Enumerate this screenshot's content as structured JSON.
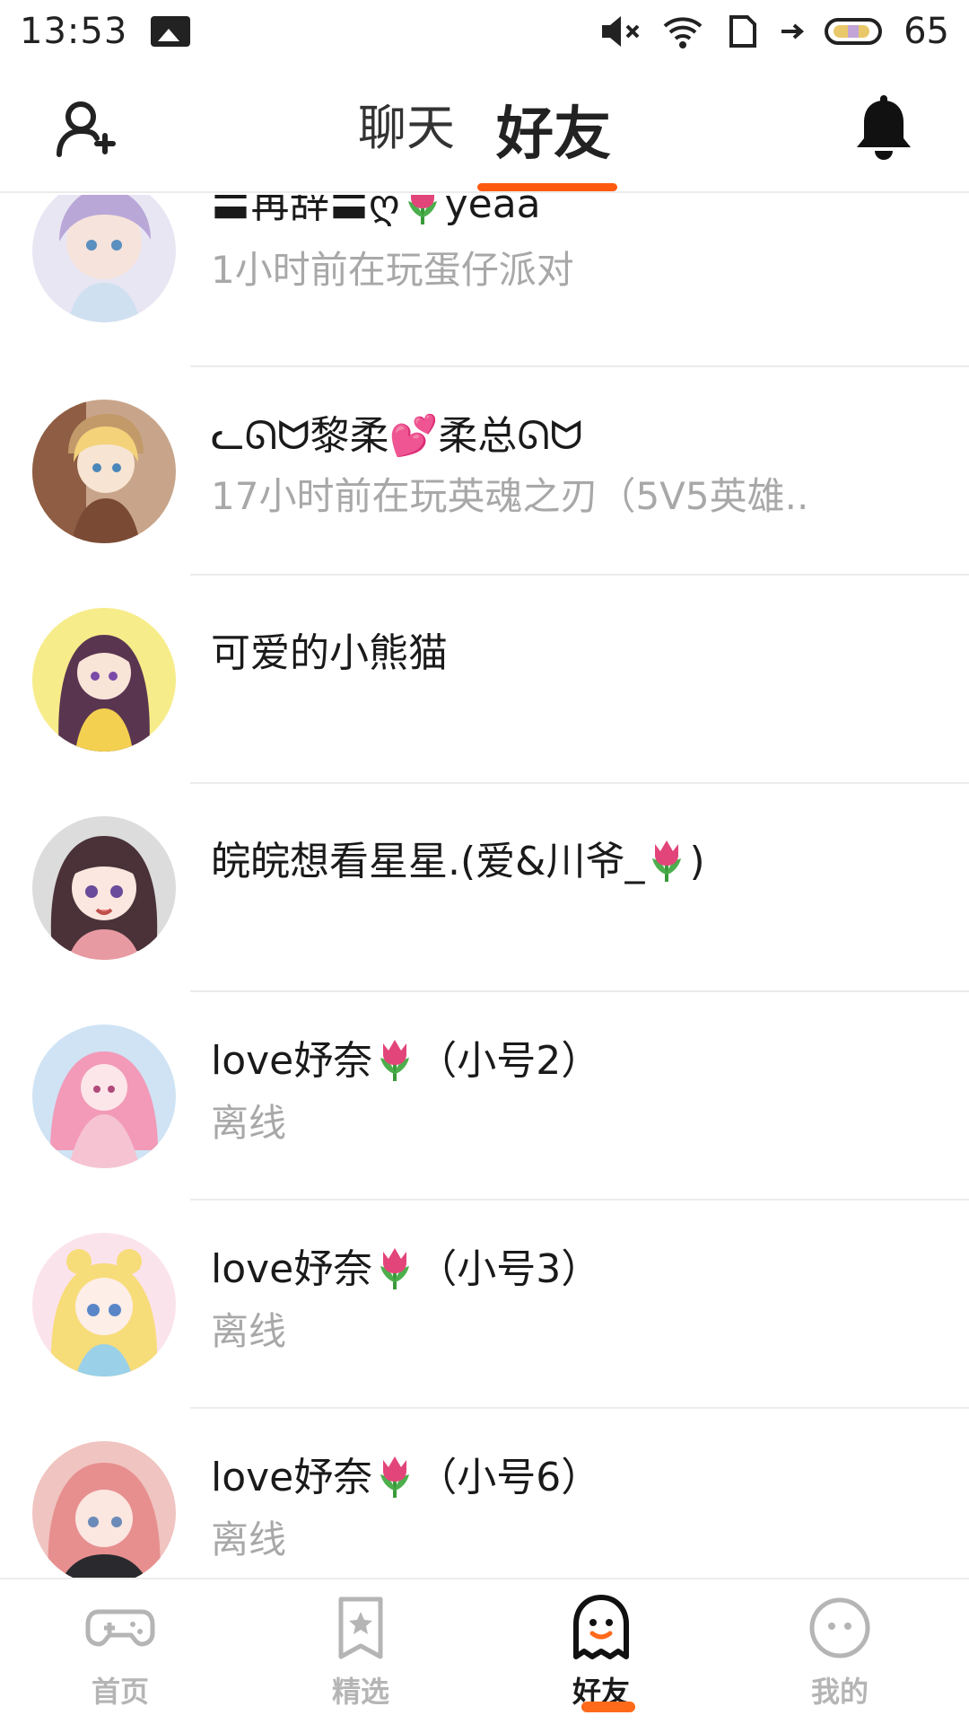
{
  "status_bar": {
    "time": "13:53",
    "battery": "65"
  },
  "header": {
    "tabs": [
      {
        "label": "聊天",
        "active": false
      },
      {
        "label": "好友",
        "active": true
      }
    ],
    "accent_color": "#ff5a0f"
  },
  "friends": [
    {
      "name_pre": "〓苒辞〓ღ",
      "name_post": "yeaa",
      "tulip": true,
      "status": "1小时前在玩蛋仔派对"
    },
    {
      "name": "ᓚᘏᗢ黎柔💕柔总ᘏᗢ",
      "status": "17小时前在玩英魂之刃（5V5英雄.."
    },
    {
      "name": "可爱的小熊猫",
      "status": ""
    },
    {
      "name_pre": "皖皖想看星星.(爱&川爷_",
      "name_post": ")",
      "tulip": true,
      "status": ""
    },
    {
      "name_pre": "love妤奈",
      "name_post": "（小号2）",
      "tulip": true,
      "status": "离线"
    },
    {
      "name_pre": "love妤奈",
      "name_post": "（小号3）",
      "tulip": true,
      "status": "离线"
    },
    {
      "name_pre": "love妤奈",
      "name_post": "（小号6）",
      "tulip": true,
      "status": "离线"
    }
  ],
  "bottom_nav": [
    {
      "label": "首页",
      "icon": "gamepad-icon",
      "active": false
    },
    {
      "label": "精选",
      "icon": "star-card-icon",
      "active": false
    },
    {
      "label": "好友",
      "icon": "ghost-icon",
      "active": true
    },
    {
      "label": "我的",
      "icon": "face-icon",
      "active": false
    }
  ]
}
